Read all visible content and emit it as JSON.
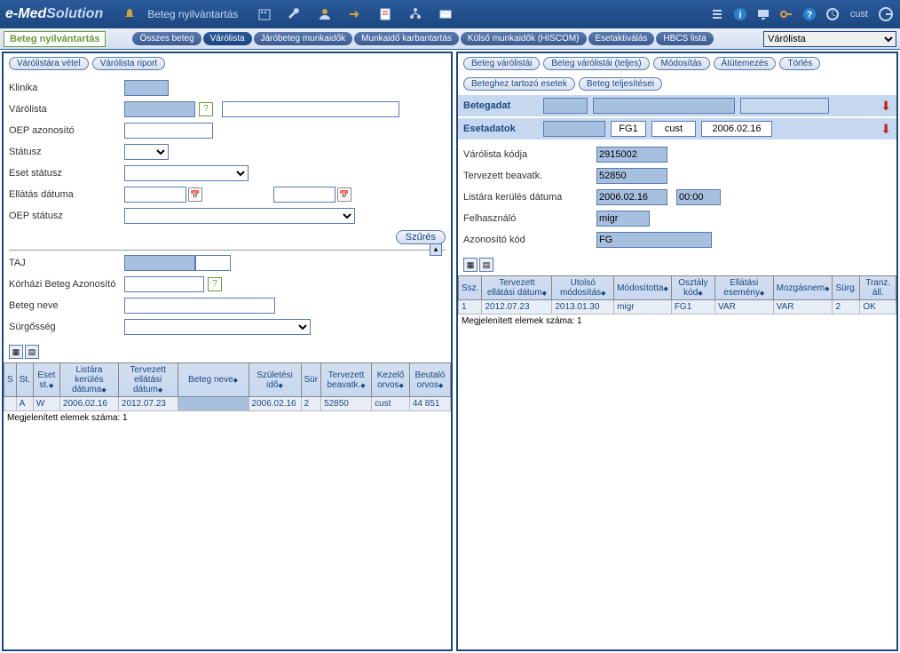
{
  "app": {
    "logo_e": "e-",
    "logo_med": "Med",
    "logo_sol": "Solution",
    "title": "Beteg nyilvántartás",
    "username": "cust"
  },
  "subheader": {
    "active_module": "Beteg nyilvántartás",
    "tabs": [
      "Összes beteg",
      "Várólista",
      "Járóbeteg munkaidők",
      "Munkaidő karbantartás",
      "Külső munkaidők (HISCOM)",
      "Esetaktiválás",
      "HBCS lista"
    ],
    "view_select": "Várólista"
  },
  "left": {
    "actions": [
      "Várólistára vétel",
      "Várólista riport"
    ],
    "filters": {
      "klinika": "Klinika",
      "varolista": "Várólista",
      "oep_azon": "OEP azonosító",
      "statusz": "Státusz",
      "eset_statusz": "Eset státusz",
      "ellatas_datuma": "Ellátás dátuma",
      "oep_statusz": "OEP státusz",
      "szures": "Szűrés",
      "taj": "TAJ",
      "korhazi": "Kórházi Beteg Azonosító",
      "beteg_neve": "Beteg neve",
      "surgosseg": "Sürgősség"
    },
    "table": {
      "headers": [
        "S",
        "St.",
        "Eset st.",
        "Listára kerülés dátuma",
        "Tervezett ellátási dátum",
        "Beteg neve",
        "Születési idő",
        "Sür",
        "Tervezett beavatk.",
        "Kezelő orvos",
        "Beutaló orvos"
      ],
      "row": [
        "",
        "A",
        "W",
        "2006.02.16",
        "2012.07.23",
        "",
        "2006.02.16",
        "2",
        "52850",
        "cust",
        "44 851"
      ],
      "count": "Megjelenített elemek száma: 1"
    }
  },
  "right": {
    "actions1": [
      "Beteg várólistái",
      "Beteg várólistái (teljes)",
      "Módosítás",
      "Átütemezés",
      "Törlés"
    ],
    "actions2": [
      "Beteghez tartozó esetek",
      "Beteg teljesítései"
    ],
    "betegadat_label": "Betegadat",
    "esetadatok_label": "Esetadatok",
    "esetadatok": {
      "fg": "FG1",
      "user": "cust",
      "date": "2006.02.16"
    },
    "details": {
      "varolista_kodja": {
        "label": "Várólista kódja",
        "value": "2915002"
      },
      "tervezett_beavatk": {
        "label": "Tervezett beavatk.",
        "value": "52850"
      },
      "listara_kerules": {
        "label": "Listára kerülés dátuma",
        "date": "2006.02.16",
        "time": "00:00"
      },
      "felhasznalo": {
        "label": "Felhasználó",
        "value": "migr"
      },
      "azonosito_kod": {
        "label": "Azonosító kód",
        "value": "FG"
      }
    },
    "table": {
      "headers": [
        "Ssz.",
        "Tervezett ellátási dátum",
        "Utolsó módosítás",
        "Módosította",
        "Osztály kód",
        "Ellátási esemény",
        "Mozgásnem",
        "Sürg.",
        "Tranz. áll."
      ],
      "row": [
        "1",
        "2012.07.23",
        "2013.01.30",
        "migr",
        "FG1",
        "VAR",
        "VAR",
        "2",
        "OK"
      ],
      "count": "Megjelenített elemek száma: 1"
    }
  }
}
